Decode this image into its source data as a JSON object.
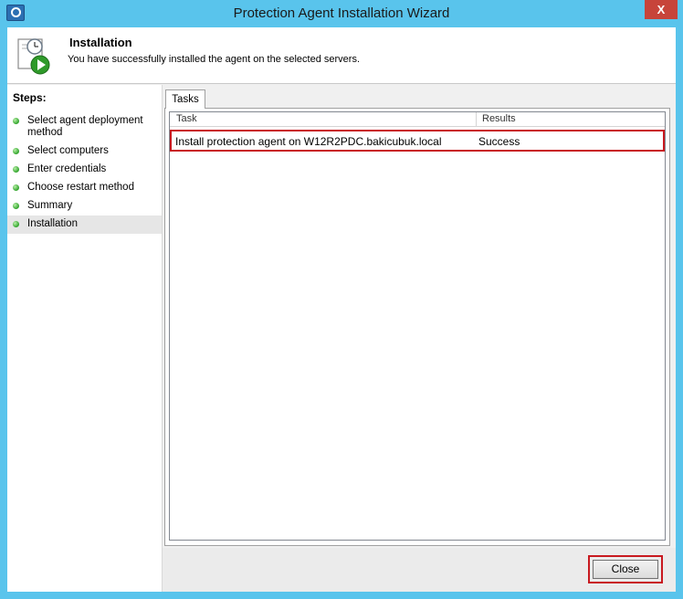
{
  "window": {
    "title": "Protection Agent Installation Wizard",
    "close_glyph": "X",
    "icon": "clock-icon"
  },
  "header": {
    "title": "Installation",
    "subtitle": "You have successfully installed the agent on the selected servers.",
    "icon": "schedule-play-icon"
  },
  "steps": {
    "title": "Steps:",
    "items": [
      {
        "label": "Select agent deployment method",
        "status": "complete"
      },
      {
        "label": "Select computers",
        "status": "complete"
      },
      {
        "label": "Enter credentials",
        "status": "complete"
      },
      {
        "label": "Choose restart method",
        "status": "complete"
      },
      {
        "label": "Summary",
        "status": "complete"
      },
      {
        "label": "Installation",
        "status": "complete",
        "active": true
      }
    ]
  },
  "tabs": [
    {
      "label": "Tasks"
    }
  ],
  "tasks_table": {
    "columns": [
      "Task",
      "Results"
    ],
    "rows": [
      {
        "task": "Install protection agent on W12R2PDC.bakicubuk.local",
        "result": "Success"
      }
    ]
  },
  "footer": {
    "close_label": "Close"
  },
  "colors": {
    "titlebar": "#59c4ec",
    "highlight": "#c8191f",
    "step_dot": "#2fa32a"
  }
}
